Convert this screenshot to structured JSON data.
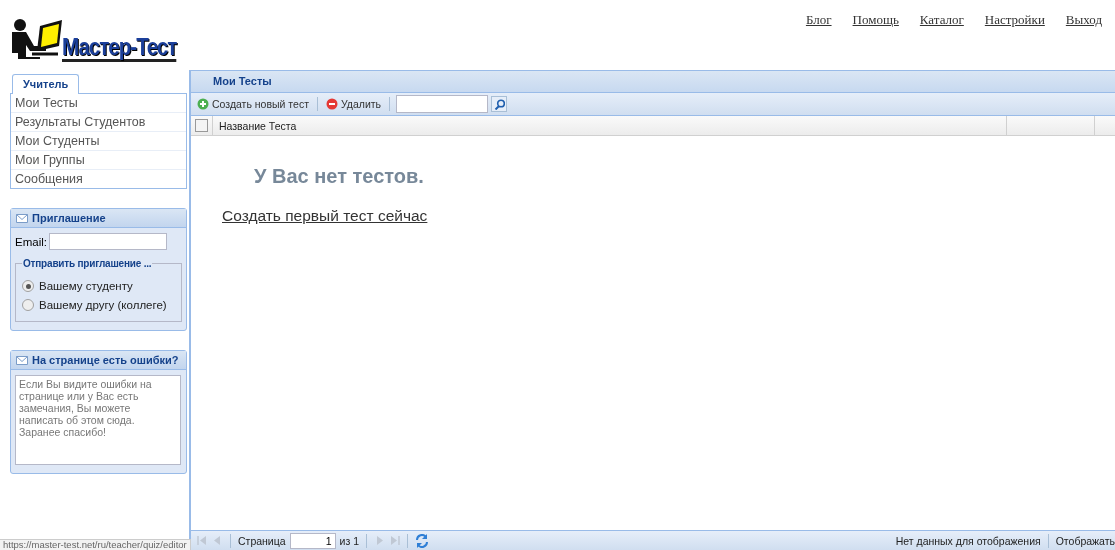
{
  "header": {
    "logo_text": "Мастер-Тест",
    "links": [
      "Блог",
      "Помощь",
      "Каталог",
      "Настройки",
      "Выход"
    ]
  },
  "sidebar": {
    "tabs": [
      {
        "label": "Учитель",
        "selected": true
      }
    ],
    "items": [
      "Мои Тесты",
      "Результаты Студентов",
      "Мои Студенты",
      "Мои Группы",
      "Сообщения"
    ]
  },
  "invite_panel": {
    "title": "Приглашение",
    "email_label": "Email:",
    "group_title": "Отправить приглашение ...",
    "options": [
      {
        "label": "Вашему студенту",
        "selected": true
      },
      {
        "label": "Вашему другу (коллеге)",
        "selected": false
      }
    ]
  },
  "feedback_panel": {
    "title": "На странице есть ошибки?",
    "placeholder": "Если Вы видите ошибки на странице или у Вас есть замечания, Вы можете написать об этом сюда.\nЗаранее спасибо!"
  },
  "main": {
    "title": "Мои Тесты",
    "toolbar": [
      {
        "kind": "add",
        "label": "Создать новый тест"
      },
      {
        "kind": "delete",
        "label": "Удалить"
      }
    ],
    "select_all": {
      "checked": false
    },
    "columns": [
      "Название Теста"
    ],
    "empty_message": "У Вас нет тестов.",
    "create_link": "Создать первый тест сейчас",
    "paging": {
      "page_label": "Страница",
      "page": "1",
      "of_label": "из 1",
      "status": "Нет данных для отображения",
      "page_size_label": "Отображать"
    }
  },
  "status_url": "https://master-test.net/ru/teacher/quiz/editor"
}
